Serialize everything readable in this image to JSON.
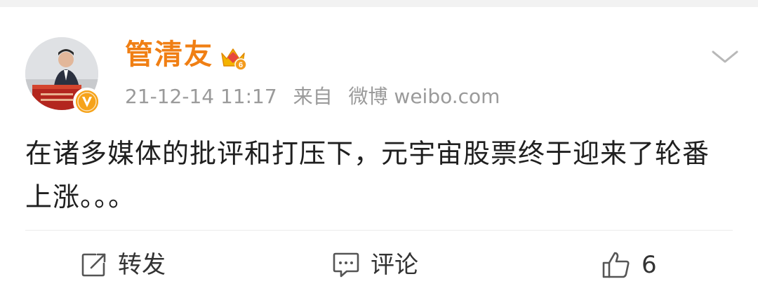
{
  "post": {
    "author": {
      "name": "管清友",
      "vip_level": "6"
    },
    "meta": {
      "timestamp": "21-12-14 11:17",
      "source_prefix": "来自",
      "source_app": "微博 weibo.com"
    },
    "text": "在诸多媒体的批评和打压下，元宇宙股票终于迎来了轮番上涨。。。"
  },
  "actions": {
    "repost_label": "转发",
    "comment_label": "评论",
    "like_count": "6"
  },
  "colors": {
    "author_name": "#f07f14",
    "meta_text": "#9a9a9a",
    "body_text": "#1f1f1f",
    "verified_badge": "#f6a31a"
  },
  "icons": {
    "verified": "verified-v-icon",
    "vip": "crown-icon",
    "menu": "chevron-down-icon",
    "repost": "share-icon",
    "comment": "comment-icon",
    "like": "thumbs-up-icon"
  }
}
